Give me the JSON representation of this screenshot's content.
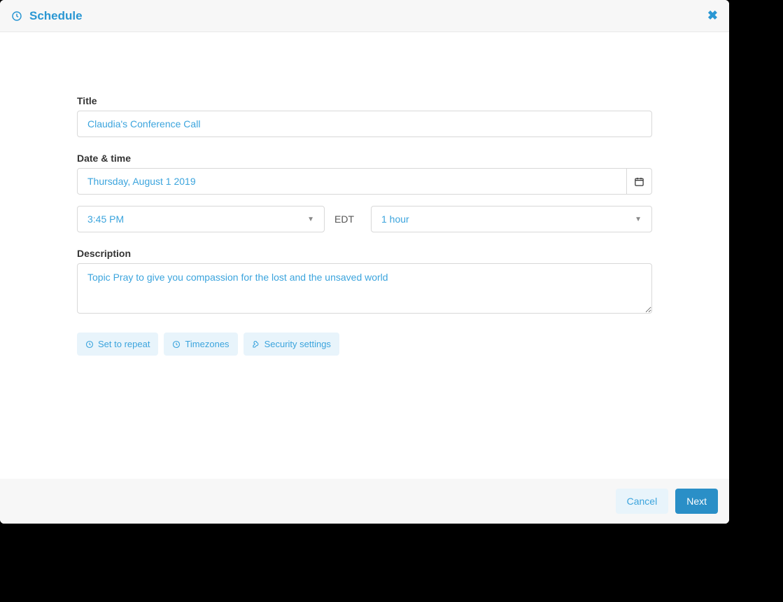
{
  "header": {
    "title": "Schedule"
  },
  "form": {
    "title_label": "Title",
    "title_value": "Claudia's Conference Call",
    "datetime_label": "Date & time",
    "date_value": "Thursday, August 1 2019",
    "time_value": "3:45 PM",
    "tz_label": "EDT",
    "duration_value": "1 hour",
    "description_label": "Description",
    "description_value": "Topic Pray to give you compassion for the lost and the unsaved world",
    "repeat_label": "Set to repeat",
    "timezones_label": "Timezones",
    "security_label": "Security settings"
  },
  "footer": {
    "cancel": "Cancel",
    "next": "Next"
  }
}
